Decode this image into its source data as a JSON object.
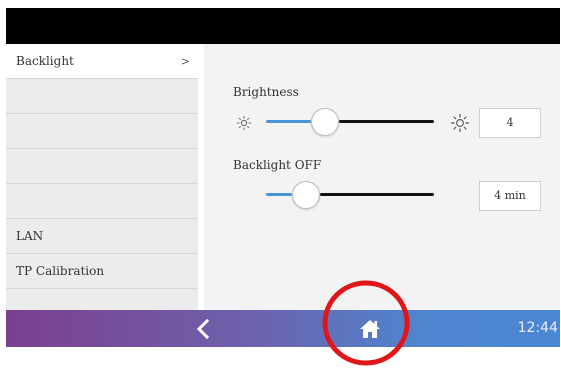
{
  "sidebar": {
    "items": [
      {
        "label": "Backlight",
        "chevron": ">",
        "active": true
      },
      {
        "label": ""
      },
      {
        "label": ""
      },
      {
        "label": ""
      },
      {
        "label": ""
      },
      {
        "label": "LAN"
      },
      {
        "label": "TP Calibration"
      }
    ]
  },
  "brightness": {
    "label": "Brightness",
    "value": "4",
    "level_fraction": 0.35,
    "icon_low": "sun-small-icon",
    "icon_high": "sun-large-icon"
  },
  "backlight_off": {
    "label": "Backlight OFF",
    "value": "4 min",
    "level_fraction": 0.24
  },
  "bottombar": {
    "back_icon": "chevron-left-icon",
    "home_icon": "home-icon",
    "time": "12:44"
  },
  "colors": {
    "slider_fill": "#4a94d6",
    "overlay_circle": "#e0161b",
    "bar_gradient_start": "#7b3f8f",
    "bar_gradient_end": "#4b86d3"
  }
}
